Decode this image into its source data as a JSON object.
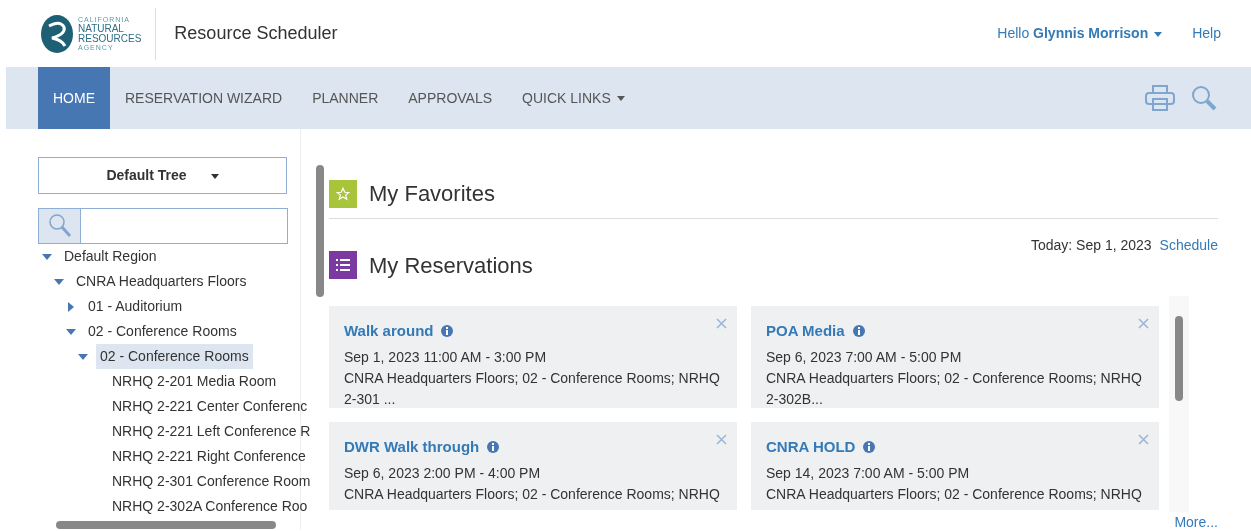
{
  "logo": {
    "lines": [
      "CALIFORNIA",
      "NATURAL",
      "RESOURCES",
      "AGENCY"
    ]
  },
  "app_title": "Resource Scheduler",
  "user_menu": {
    "greeting": "Hello",
    "name": "Glynnis Morrison"
  },
  "help": "Help",
  "nav": [
    {
      "label": "HOME",
      "selected": true,
      "dropdown": false
    },
    {
      "label": "RESERVATION WIZARD",
      "selected": false,
      "dropdown": false
    },
    {
      "label": "PLANNER",
      "selected": false,
      "dropdown": false
    },
    {
      "label": "APPROVALS",
      "selected": false,
      "dropdown": false
    },
    {
      "label": "QUICK LINKS",
      "selected": false,
      "dropdown": true
    }
  ],
  "tree_select": "Default Tree",
  "tree": [
    {
      "label": "Default Region",
      "expanded": true,
      "selected": false,
      "children": [
        {
          "label": "CNRA Headquarters Floors",
          "expanded": true,
          "selected": false,
          "children": [
            {
              "label": "01 - Auditorium",
              "expanded": false,
              "selected": false
            },
            {
              "label": "02 - Conference Rooms",
              "expanded": true,
              "selected": false,
              "children": [
                {
                  "label": "02 - Conference Rooms",
                  "expanded": true,
                  "selected": true,
                  "children": [
                    {
                      "label": "NRHQ 2-201 Media Room",
                      "selected": false
                    },
                    {
                      "label": "NRHQ 2-221 Center Conferenc",
                      "selected": false
                    },
                    {
                      "label": "NRHQ 2-221 Left Conference R",
                      "selected": false
                    },
                    {
                      "label": "NRHQ 2-221 Right Conference",
                      "selected": false
                    },
                    {
                      "label": "NRHQ 2-301 Conference Room",
                      "selected": false
                    },
                    {
                      "label": "NRHQ 2-302A Conference Roo",
                      "selected": false
                    }
                  ]
                }
              ]
            }
          ]
        }
      ]
    }
  ],
  "favorites": {
    "title": "My Favorites"
  },
  "reservations": {
    "title": "My Reservations",
    "today": "Today: Sep 1, 2023",
    "schedule_link": "Schedule",
    "more_link": "More...",
    "items": [
      {
        "title": "Walk around",
        "when": "Sep 1, 2023 11:00 AM - 3:00 PM",
        "where": "CNRA Headquarters Floors; 02 - Conference Rooms; NRHQ 2-301 ..."
      },
      {
        "title": "POA Media",
        "when": "Sep 6, 2023 7:00 AM - 5:00 PM",
        "where": "CNRA Headquarters Floors; 02 - Conference Rooms; NRHQ 2-302B..."
      },
      {
        "title": "DWR Walk through",
        "when": "Sep 6, 2023 2:00 PM - 4:00 PM",
        "where": "CNRA Headquarters Floors; 02 - Conference Rooms; NRHQ"
      },
      {
        "title": "CNRA HOLD",
        "when": "Sep 14, 2023 7:00 AM - 5:00 PM",
        "where": "CNRA Headquarters Floors; 02 - Conference Rooms; NRHQ"
      }
    ]
  }
}
